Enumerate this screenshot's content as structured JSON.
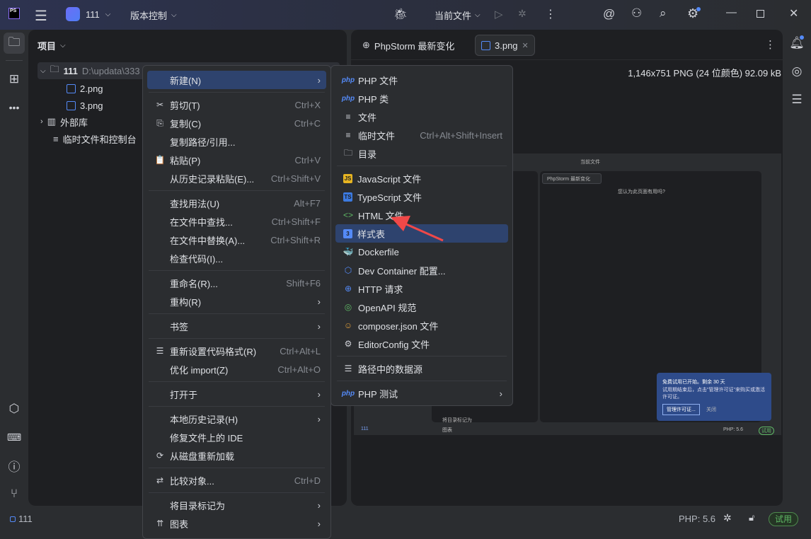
{
  "titlebar": {
    "app_logo": "PS",
    "project_name": "111",
    "vcs_label": "版本控制",
    "run_config": "当前文件"
  },
  "project_panel": {
    "title": "项目",
    "tree": [
      {
        "label": "111",
        "path": "D:\\updata\\333",
        "type": "folder"
      },
      {
        "label": "2.png",
        "type": "image"
      },
      {
        "label": "3.png",
        "type": "image"
      },
      {
        "label": "外部库",
        "type": "library"
      },
      {
        "label": "临时文件和控制台",
        "type": "scratch"
      }
    ]
  },
  "editor": {
    "tabs": [
      {
        "label": "PhpStorm 最新变化",
        "active": false
      },
      {
        "label": "3.png",
        "active": true
      }
    ],
    "image_info": "1,146x751 PNG (24 位颜色) 92.09 kB",
    "preview": {
      "run_config": "当前文件",
      "tab": "PhpStorm 最新变化",
      "question": "您认为此页面有用吗?",
      "notif_title": "免费试用已开始。剩余 30 天",
      "notif_body": "试用期结束后，点击\"管理许可证\"来购买或激活许可证。",
      "notif_button": "管理许可证...",
      "notif_close": "关闭",
      "php": "PHP: 5.6",
      "trial": "试用",
      "project": "111",
      "menu_mark": "将目录标记为",
      "menu_chart": "图表"
    }
  },
  "context_menu": [
    {
      "label": "新建(N)",
      "submenu": true,
      "selected": true
    },
    {
      "sep": true
    },
    {
      "label": "剪切(T)",
      "shortcut": "Ctrl+X",
      "icon": "✂"
    },
    {
      "label": "复制(C)",
      "shortcut": "Ctrl+C",
      "icon": "⎘"
    },
    {
      "label": "复制路径/引用..."
    },
    {
      "label": "粘贴(P)",
      "shortcut": "Ctrl+V",
      "icon": "📋"
    },
    {
      "label": "从历史记录粘贴(E)...",
      "shortcut": "Ctrl+Shift+V"
    },
    {
      "sep": true
    },
    {
      "label": "查找用法(U)",
      "shortcut": "Alt+F7"
    },
    {
      "label": "在文件中查找...",
      "shortcut": "Ctrl+Shift+F"
    },
    {
      "label": "在文件中替换(A)...",
      "shortcut": "Ctrl+Shift+R"
    },
    {
      "label": "检查代码(I)..."
    },
    {
      "sep": true
    },
    {
      "label": "重命名(R)...",
      "shortcut": "Shift+F6"
    },
    {
      "label": "重构(R)",
      "submenu": true
    },
    {
      "sep": true
    },
    {
      "label": "书签",
      "submenu": true
    },
    {
      "sep": true
    },
    {
      "label": "重新设置代码格式(R)",
      "shortcut": "Ctrl+Alt+L",
      "icon": "☰"
    },
    {
      "label": "优化 import(Z)",
      "shortcut": "Ctrl+Alt+O"
    },
    {
      "sep": true
    },
    {
      "label": "打开于",
      "submenu": true
    },
    {
      "sep": true
    },
    {
      "label": "本地历史记录(H)",
      "submenu": true
    },
    {
      "label": "修复文件上的 IDE"
    },
    {
      "label": "从磁盘重新加载",
      "icon": "⟳"
    },
    {
      "sep": true
    },
    {
      "label": "比较对象...",
      "shortcut": "Ctrl+D",
      "icon": "⇄"
    },
    {
      "sep": true
    },
    {
      "label": "将目录标记为",
      "submenu": true
    },
    {
      "label": "图表",
      "submenu": true,
      "icon": "⇈"
    }
  ],
  "new_submenu": [
    {
      "label": "PHP 文件",
      "icon": "php",
      "color": "#548af7"
    },
    {
      "label": "PHP 类",
      "icon": "php",
      "color": "#548af7"
    },
    {
      "label": "文件",
      "icon": "≡"
    },
    {
      "label": "临时文件",
      "shortcut": "Ctrl+Alt+Shift+Insert",
      "icon": "≡"
    },
    {
      "label": "目录",
      "icon": "🗀"
    },
    {
      "sep": true
    },
    {
      "label": "JavaScript 文件",
      "icon": "JS",
      "color": "#e6b422"
    },
    {
      "label": "TypeScript 文件",
      "icon": "TS",
      "color": "#3c7ae0"
    },
    {
      "label": "HTML 文件",
      "icon": "<>",
      "color": "#5fb865"
    },
    {
      "label": "样式表",
      "icon": "3",
      "color": "#548af7",
      "selected": true
    },
    {
      "label": "Dockerfile",
      "icon": "🐳",
      "color": "#548af7"
    },
    {
      "label": "Dev Container 配置...",
      "icon": "⬡",
      "color": "#548af7"
    },
    {
      "label": "HTTP 请求",
      "icon": "⊕",
      "color": "#548af7"
    },
    {
      "label": "OpenAPI 规范",
      "icon": "◎",
      "color": "#5fb865"
    },
    {
      "label": "composer.json 文件",
      "icon": "☺",
      "color": "#d89a3a"
    },
    {
      "label": "EditorConfig 文件",
      "icon": "⚙"
    },
    {
      "sep": true
    },
    {
      "label": "路径中的数据源",
      "icon": "☰"
    },
    {
      "sep": true
    },
    {
      "label": "PHP 测试",
      "icon": "php",
      "color": "#548af7",
      "submenu": true
    }
  ],
  "statusbar": {
    "project": "111",
    "php_version": "PHP: 5.6",
    "trial": "试用"
  },
  "colors": {
    "accent": "#548af7",
    "selection": "#2e436e",
    "trial": "#5fb865",
    "annotation": "#f04848"
  }
}
